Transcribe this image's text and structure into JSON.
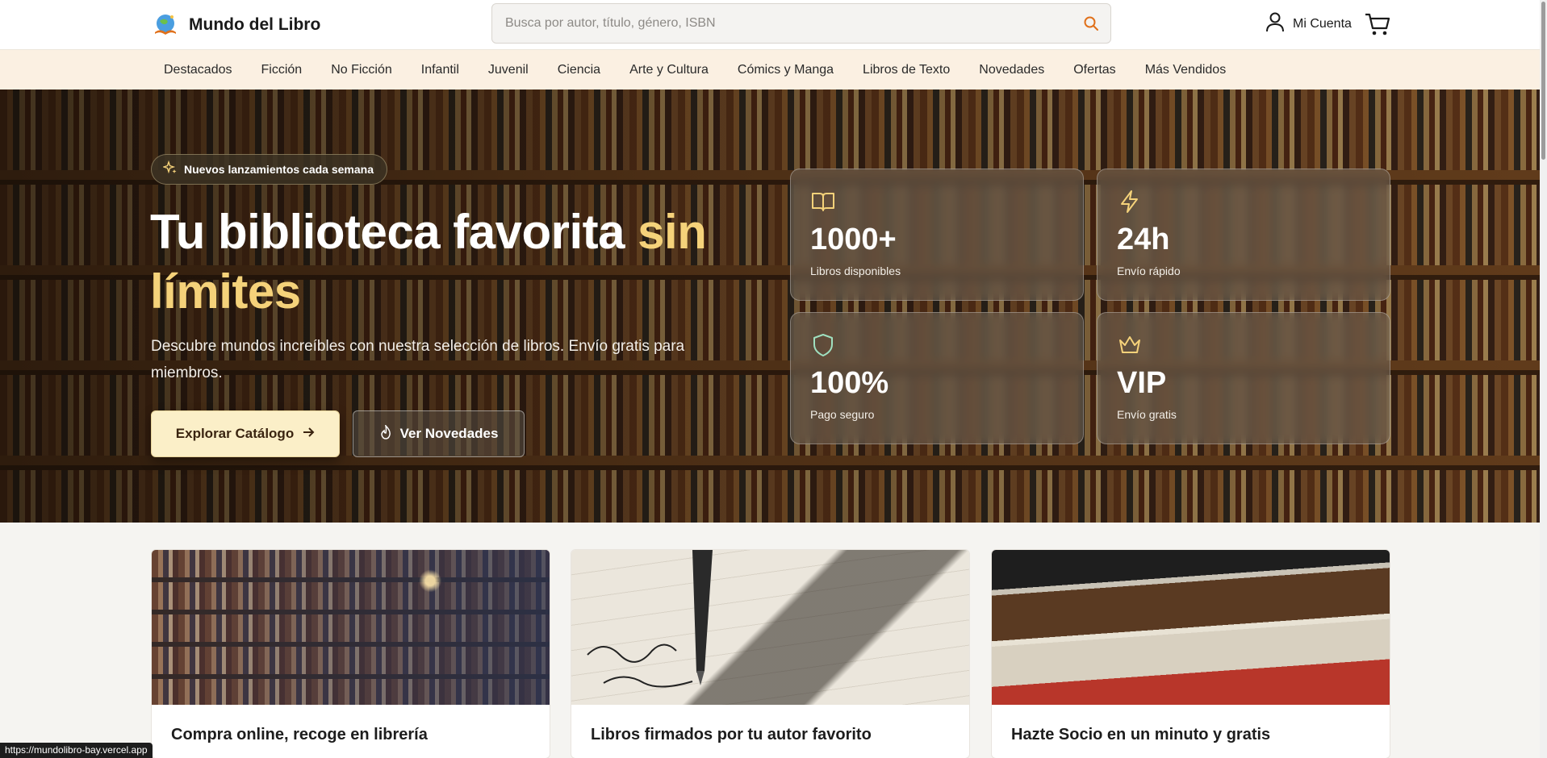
{
  "header": {
    "brand": "Mundo del Libro",
    "search_placeholder": "Busca por autor, título, género, ISBN",
    "search_value": "",
    "account_label": "Mi Cuenta",
    "icons": [
      "globe-book-logo",
      "search-icon",
      "user-icon",
      "cart-icon"
    ]
  },
  "nav": {
    "items": [
      "Destacados",
      "Ficción",
      "No Ficción",
      "Infantil",
      "Juvenil",
      "Ciencia",
      "Arte y Cultura",
      "Cómics y Manga",
      "Libros de Texto",
      "Novedades",
      "Ofertas",
      "Más Vendidos"
    ]
  },
  "hero": {
    "badge": "Nuevos lanzamientos cada semana",
    "title_main": "Tu biblioteca favorita ",
    "title_highlight": "sin límites",
    "subtitle": "Descubre mundos increíbles con nuestra selección de libros. Envío gratis para miembros.",
    "primary_button": "Explorar Catálogo",
    "secondary_button": "Ver Novedades",
    "stats": [
      {
        "value": "1000+",
        "label": "Libros disponibles",
        "icon": "book-open-icon"
      },
      {
        "value": "24h",
        "label": "Envío rápido",
        "icon": "lightning-icon"
      },
      {
        "value": "100%",
        "label": "Pago seguro",
        "icon": "shield-icon"
      },
      {
        "value": "VIP",
        "label": "Envío gratis",
        "icon": "crown-icon"
      }
    ]
  },
  "promos": [
    {
      "title": "Compra online, recoge en librería"
    },
    {
      "title": "Libros firmados por tu autor favorito"
    },
    {
      "title": "Hazte Socio en un minuto y gratis"
    }
  ],
  "status_bar_url": "https://mundolibro-bay.vercel.app",
  "colors": {
    "accent_yellow": "#f5d27a",
    "nav_background": "#fbf0e2",
    "primary_button_bg": "#fbefc8",
    "search_icon": "#e0701a"
  }
}
